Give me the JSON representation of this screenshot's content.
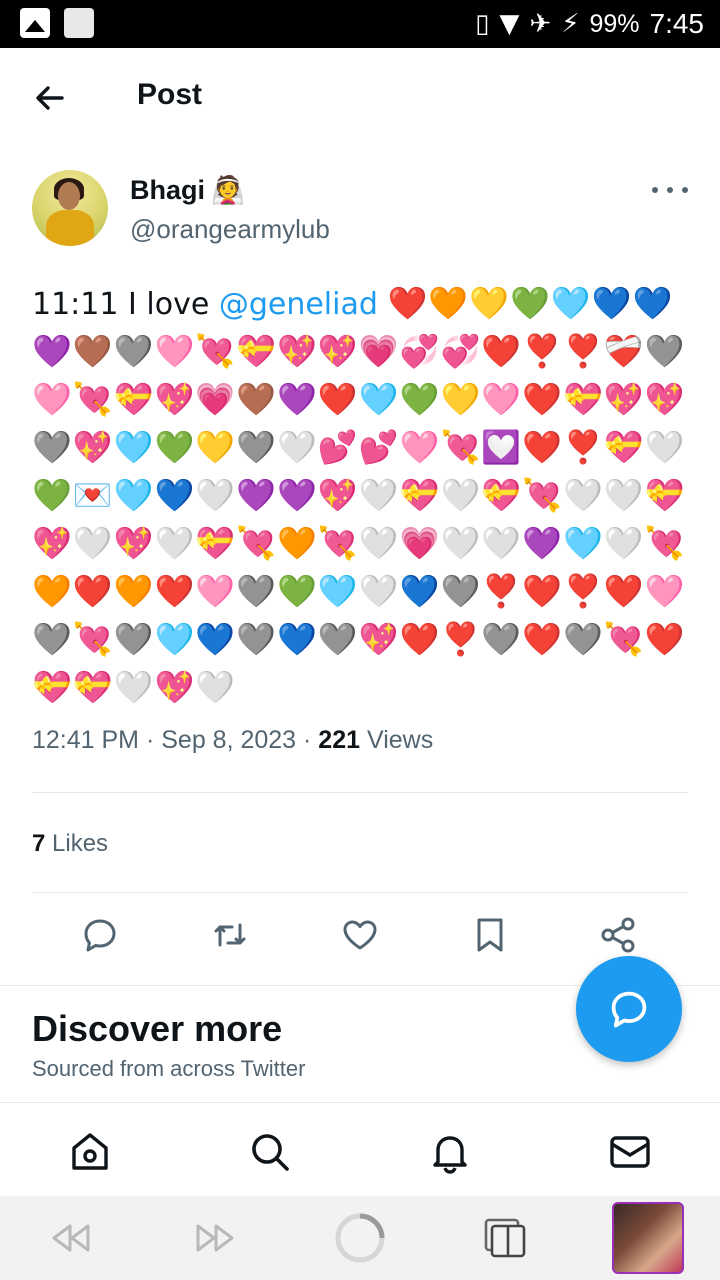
{
  "status_bar": {
    "battery": "99%",
    "time": "7:45"
  },
  "header": {
    "title": "Post"
  },
  "tweet": {
    "author_name": "Bhagi",
    "author_badge_emoji": "👰",
    "handle": "@orangearmylub",
    "text_prefix": "11:11 I love ",
    "mention": "@geneliad",
    "emojis": "❤️🧡💛💚🩵💙💙💜🤎🩶🩷💘💝💖💖💗💞💞❤️❣️❣️❤️‍🩹🩶🩷💘💝💖💗🤎💜❤️🩵💚💛🩷❤️💝💖💖🩶💖🩵💚💛🩶🤍💕💕🩷💘💟❤️❣️💝🤍💚💌🩵💙🤍💜💜💖🤍💝🤍💝💘🤍🤍💝💖🤍💖🤍💝💘🧡💘🤍💗🤍🤍💜🩵🤍💘🧡❤️🧡❤️🩷🩶💚🩵🤍💙🩶❣️❤️❣️❤️🩷🩶💘🩶🩵💙🩶💙🩶💖❤️❣️🩶❤️🩶💘❤️💝💝🤍💖🤍",
    "time": "12:41 PM",
    "date": "Sep 8, 2023",
    "views_count": "221",
    "views_label": "Views",
    "likes_count": "7",
    "likes_label": "Likes"
  },
  "discover": {
    "title": "Discover more",
    "subtitle": "Sourced from across Twitter"
  },
  "colors": {
    "accent": "#1d9bf0",
    "text": "#0f1419",
    "muted": "#536471"
  }
}
